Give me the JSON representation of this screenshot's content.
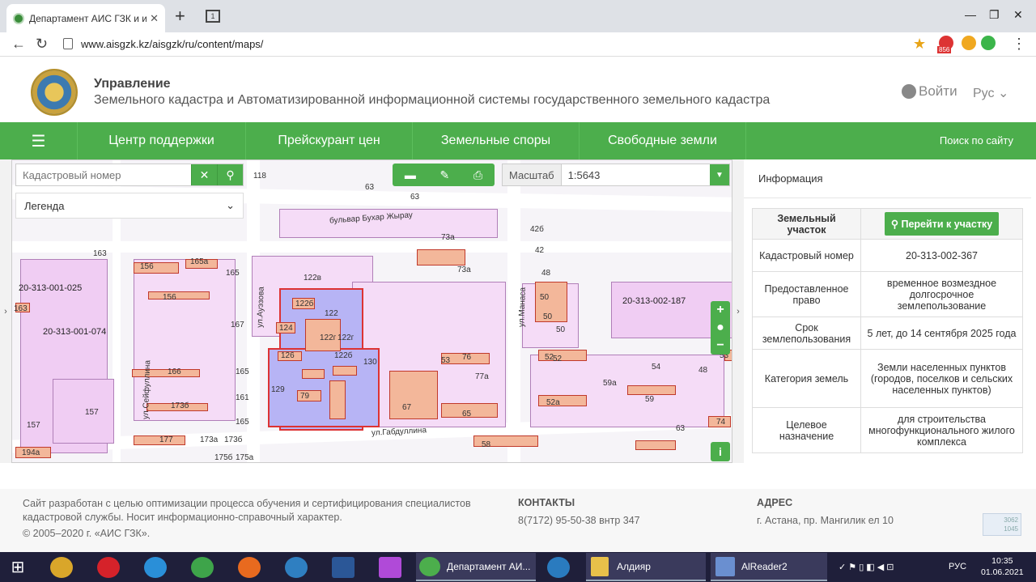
{
  "browser": {
    "tab_title": "Департамент АИС ГЗК и ин",
    "tab_close": "✕",
    "new_tab": "+",
    "url": "www.aisgzk.kz/aisgzk/ru/content/maps/",
    "ext_badge": "856"
  },
  "header": {
    "title": "Управление",
    "subtitle": "Земельного кадастра и Автоматизированной информационной системы государственного земельного кадастра",
    "login": "Войти",
    "lang": "Рус"
  },
  "nav": {
    "items": [
      "Центр поддержки",
      "Прейскурант цен",
      "Земельные споры",
      "Свободные земли"
    ],
    "search": "Поиск по сайту"
  },
  "map": {
    "cadastral_placeholder": "Кадастровый номер",
    "legend": "Легенда",
    "scale_label": "Масштаб",
    "scale_value": "1:5643",
    "streets": [
      "бульвар Бухар Жырау",
      "ул.Ауэзова",
      "ул.Манаса",
      "ул.Габдуллина",
      "ул.Сейфуллина"
    ],
    "block_labels": [
      "20-313-001-025",
      "20-313-001-074",
      "20-313-002-187"
    ],
    "parcel_labels": [
      "118",
      "63",
      "63",
      "163",
      "156",
      "165а",
      "165",
      "156",
      "163",
      "167",
      "122в",
      "122б",
      "122",
      "122г",
      "122г",
      "124",
      "126",
      "122б",
      "130",
      "129",
      "166",
      "165",
      "161",
      "165",
      "173б",
      "173а",
      "177",
      "173б",
      "175б",
      "175а",
      "79",
      "67",
      "65",
      "73а",
      "73а",
      "76",
      "52",
      "53",
      "77а",
      "42б",
      "42",
      "48",
      "50",
      "50",
      "50",
      "52",
      "59а",
      "52а",
      "54",
      "59",
      "58",
      "48",
      "53",
      "194а",
      "157",
      "157",
      "74",
      "63"
    ]
  },
  "panel": {
    "header": "Информация",
    "section_title": "Земельный участок",
    "goto_button": "Перейти к участку",
    "rows": [
      {
        "label": "Кадастровый номер",
        "value": "20-313-002-367"
      },
      {
        "label": "Предоставленное право",
        "value": "временное возмездное долгосрочное землепользование"
      },
      {
        "label": "Срок землепользования",
        "value": "5 лет, до 14 сентября 2025 года"
      },
      {
        "label": "Категория земель",
        "value": "Земли населенных пунктов (городов, поселков и сельских населенных пунктов)"
      },
      {
        "label": "Целевое назначение",
        "value": "для строительства многофункционального жилого комплекса"
      }
    ]
  },
  "footer": {
    "about": "Сайт разработан с целью оптимизации процесса обучения и сертифицирования специалистов кадастровой службы. Носит информационно-справочный характер.",
    "copyright": "© 2005–2020 г. «АИС ГЗК».",
    "contacts_title": "КОНТАКТЫ",
    "contacts_value": "8(7172) 95-50-38 внтр 347",
    "address_title": "АДРЕС",
    "address_value": "г. Астана, пр. Мангилик ел 10",
    "counter_top": "3062",
    "counter_bottom": "1045"
  },
  "taskbar": {
    "windows": [
      "Департамент АИ...",
      "Алдияр",
      "AlReader2"
    ],
    "tray_lang": "РУС",
    "time": "10:35",
    "date": "01.06.2021"
  },
  "colors": {
    "accent": "#4cae4c",
    "selected_parcel": "#b7b4f5",
    "parcel": "#f5dcf7"
  }
}
